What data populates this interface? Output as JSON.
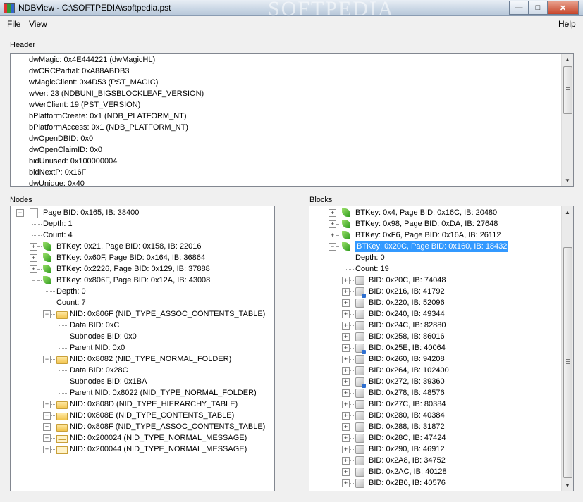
{
  "window": {
    "title": "NDBView - C:\\SOFTPEDIA\\softpedia.pst",
    "watermark": "SOFTPEDIA"
  },
  "menu": {
    "file": "File",
    "view": "View",
    "help": "Help"
  },
  "sections": {
    "header": "Header",
    "nodes": "Nodes",
    "blocks": "Blocks"
  },
  "header_items": [
    "dwMagic: 0x4E444221 (dwMagicHL)",
    "dwCRCPartial: 0xA88ABDB3",
    "wMagicClient: 0x4D53 (PST_MAGIC)",
    "wVer: 23 (NDBUNI_BIGSBLOCKLEAF_VERSION)",
    "wVerClient: 19 (PST_VERSION)",
    "bPlatformCreate: 0x1 (NDB_PLATFORM_NT)",
    "bPlatformAccess: 0x1 (NDB_PLATFORM_NT)",
    "dwOpenDBID: 0x0",
    "dwOpenClaimID: 0x0",
    "bidUnused: 0x100000004",
    "bidNextP: 0x16F",
    "dwUnique: 0x40"
  ],
  "nodes": [
    {
      "text": "Page BID: 0x165, IB: 38400",
      "icon": "page-icon",
      "exp": "-"
    },
    {
      "text": "Depth: 1",
      "icon": "",
      "exp": ""
    },
    {
      "text": "Count: 4",
      "icon": "",
      "exp": ""
    },
    {
      "text": "BTKey: 0x21, Page BID: 0x158, IB: 22016",
      "icon": "leaf-icon",
      "exp": "+"
    },
    {
      "text": "BTKey: 0x60F, Page BID: 0x164, IB: 36864",
      "icon": "leaf-icon",
      "exp": "+"
    },
    {
      "text": "BTKey: 0x2226, Page BID: 0x129, IB: 37888",
      "icon": "leaf-icon",
      "exp": "+"
    },
    {
      "text": "BTKey: 0x806F, Page BID: 0x12A, IB: 43008",
      "icon": "leaf-icon",
      "exp": "-"
    },
    {
      "text": "Depth: 0",
      "icon": "",
      "exp": ""
    },
    {
      "text": "Count: 7",
      "icon": "",
      "exp": ""
    },
    {
      "text": "NID: 0x806F (NID_TYPE_ASSOC_CONTENTS_TABLE)",
      "icon": "folder-icon",
      "exp": "-"
    },
    {
      "text": "Data BID: 0xC",
      "icon": "",
      "exp": ""
    },
    {
      "text": "Subnodes BID: 0x0",
      "icon": "",
      "exp": ""
    },
    {
      "text": "Parent NID: 0x0",
      "icon": "",
      "exp": ""
    },
    {
      "text": "NID: 0x8082 (NID_TYPE_NORMAL_FOLDER)",
      "icon": "folder-icon",
      "exp": "-"
    },
    {
      "text": "Data BID: 0x28C",
      "icon": "",
      "exp": ""
    },
    {
      "text": "Subnodes BID: 0x1BA",
      "icon": "",
      "exp": ""
    },
    {
      "text": "Parent NID: 0x8022 (NID_TYPE_NORMAL_FOLDER)",
      "icon": "",
      "exp": ""
    },
    {
      "text": "NID: 0x808D (NID_TYPE_HIERARCHY_TABLE)",
      "icon": "folder-icon",
      "exp": "+"
    },
    {
      "text": "NID: 0x808E (NID_TYPE_CONTENTS_TABLE)",
      "icon": "folder-icon",
      "exp": "+"
    },
    {
      "text": "NID: 0x808F (NID_TYPE_ASSOC_CONTENTS_TABLE)",
      "icon": "folder-icon",
      "exp": "+"
    },
    {
      "text": "NID: 0x200024 (NID_TYPE_NORMAL_MESSAGE)",
      "icon": "mail-icon",
      "exp": "+"
    },
    {
      "text": "NID: 0x200044 (NID_TYPE_NORMAL_MESSAGE)",
      "icon": "mail-icon",
      "exp": "+"
    }
  ],
  "blocks": [
    {
      "text": "BTKey: 0x4, Page BID: 0x16C, IB: 20480",
      "icon": "leaf-icon",
      "exp": "+"
    },
    {
      "text": "BTKey: 0x98, Page BID: 0xDA, IB: 27648",
      "icon": "leaf-icon",
      "exp": "+"
    },
    {
      "text": "BTKey: 0xF6, Page BID: 0x16A, IB: 26112",
      "icon": "leaf-icon",
      "exp": "+"
    },
    {
      "text": "BTKey: 0x20C, Page BID: 0x160, IB: 18432",
      "icon": "leaf-icon",
      "exp": "-",
      "selected": true
    },
    {
      "text": "Depth: 0",
      "icon": "",
      "exp": ""
    },
    {
      "text": "Count: 19",
      "icon": "",
      "exp": ""
    },
    {
      "text": "BID: 0x20C, IB: 74048",
      "icon": "block-icon",
      "exp": "+"
    },
    {
      "text": "BID: 0x216, IB: 41792",
      "icon": "block-sub-icon",
      "exp": "+"
    },
    {
      "text": "BID: 0x220, IB: 52096",
      "icon": "block-icon",
      "exp": "+"
    },
    {
      "text": "BID: 0x240, IB: 49344",
      "icon": "block-icon",
      "exp": "+"
    },
    {
      "text": "BID: 0x24C, IB: 82880",
      "icon": "block-icon",
      "exp": "+"
    },
    {
      "text": "BID: 0x258, IB: 86016",
      "icon": "block-icon",
      "exp": "+"
    },
    {
      "text": "BID: 0x25E, IB: 40064",
      "icon": "block-sub-icon",
      "exp": "+"
    },
    {
      "text": "BID: 0x260, IB: 94208",
      "icon": "block-icon",
      "exp": "+"
    },
    {
      "text": "BID: 0x264, IB: 102400",
      "icon": "block-icon",
      "exp": "+"
    },
    {
      "text": "BID: 0x272, IB: 39360",
      "icon": "block-sub-icon",
      "exp": "+"
    },
    {
      "text": "BID: 0x278, IB: 48576",
      "icon": "block-icon",
      "exp": "+"
    },
    {
      "text": "BID: 0x27C, IB: 80384",
      "icon": "block-icon",
      "exp": "+"
    },
    {
      "text": "BID: 0x280, IB: 40384",
      "icon": "block-icon",
      "exp": "+"
    },
    {
      "text": "BID: 0x288, IB: 31872",
      "icon": "block-icon",
      "exp": "+"
    },
    {
      "text": "BID: 0x28C, IB: 47424",
      "icon": "block-icon",
      "exp": "+"
    },
    {
      "text": "BID: 0x290, IB: 46912",
      "icon": "block-icon",
      "exp": "+"
    },
    {
      "text": "BID: 0x2A8, IB: 34752",
      "icon": "block-icon",
      "exp": "+"
    },
    {
      "text": "BID: 0x2AC, IB: 40128",
      "icon": "block-icon",
      "exp": "+"
    },
    {
      "text": "BID: 0x2B0, IB: 40576",
      "icon": "block-icon",
      "exp": "+"
    }
  ],
  "colors": {
    "selection": "#3399ff",
    "panel_border": "#828790",
    "background": "#f0f0f0"
  }
}
